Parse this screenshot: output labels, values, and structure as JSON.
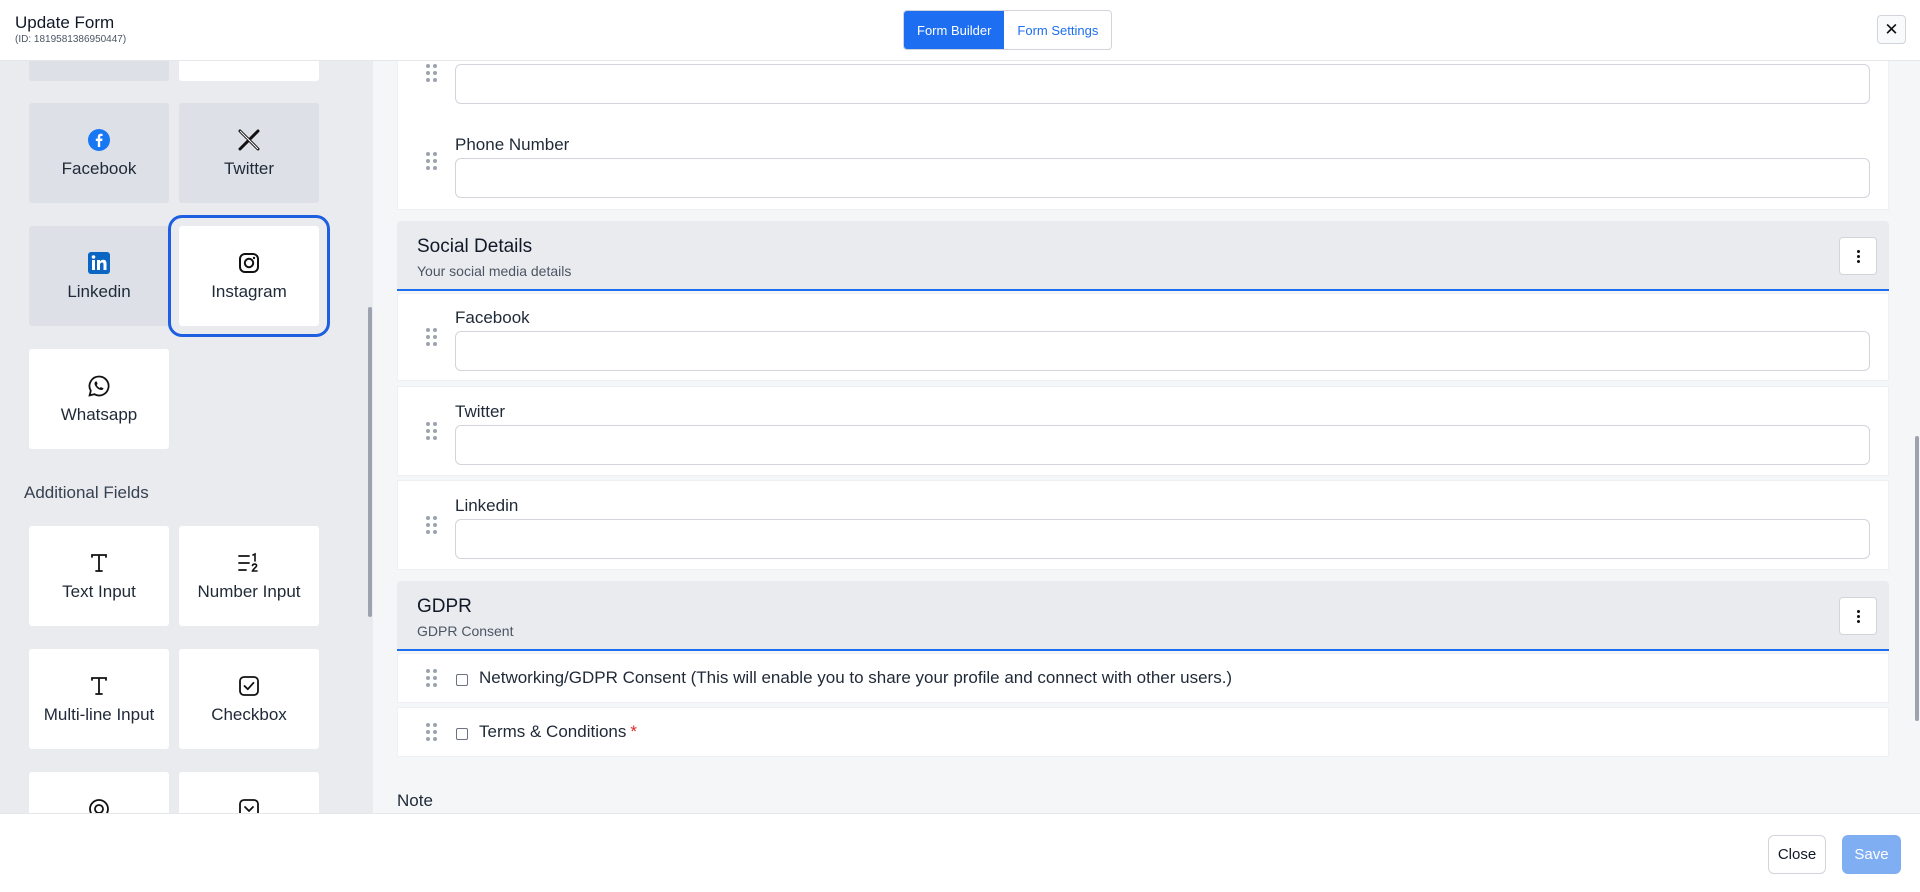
{
  "header": {
    "title": "Update Form",
    "subtitle": "(ID: 1819581386950447)",
    "tabs": [
      {
        "label": "Form Builder",
        "active": true
      },
      {
        "label": "Form Settings",
        "active": false
      }
    ],
    "close_icon": "close-icon"
  },
  "left": {
    "social_tiles": [
      {
        "label": "Facebook",
        "icon": "facebook-icon"
      },
      {
        "label": "Twitter",
        "icon": "x-twitter-icon"
      },
      {
        "label": "Linkedin",
        "icon": "linkedin-icon"
      },
      {
        "label": "Instagram",
        "icon": "instagram-icon",
        "selected": true
      },
      {
        "label": "Whatsapp",
        "icon": "whatsapp-icon"
      }
    ],
    "additional_fields_label": "Additional Fields",
    "additional_tiles": [
      {
        "label": "Text Input",
        "icon": "text-input-icon"
      },
      {
        "label": "Number Input",
        "icon": "number-input-icon"
      },
      {
        "label": "Multi-line Input",
        "icon": "multiline-input-icon"
      },
      {
        "label": "Checkbox",
        "icon": "checkbox-icon"
      }
    ]
  },
  "form": {
    "phone_label": "Phone Number",
    "social_section": {
      "title": "Social Details",
      "subtitle": "Your social media details",
      "fields": [
        "Facebook",
        "Twitter",
        "Linkedin"
      ]
    },
    "gdpr_section": {
      "title": "GDPR",
      "subtitle": "GDPR Consent",
      "consent_label": "Networking/GDPR Consent (This will enable you to share your profile and connect with other users.)",
      "terms_label": "Terms & Conditions",
      "required_mark": "*"
    },
    "note_label": "Note"
  },
  "footer": {
    "close_label": "Close",
    "save_label": "Save"
  },
  "colors": {
    "accent": "#1d6ef1",
    "save_disabled": "#80aef2",
    "required": "#dc2626"
  }
}
